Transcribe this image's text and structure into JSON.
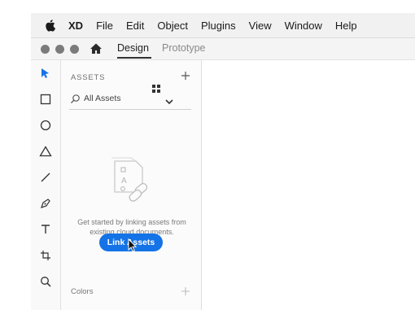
{
  "menu": {
    "apple_icon": "apple-icon",
    "app_name": "XD",
    "items": [
      "File",
      "Edit",
      "Object",
      "Plugins",
      "View",
      "Window",
      "Help"
    ]
  },
  "toolbar": {
    "tabs": [
      {
        "label": "Design",
        "active": true
      },
      {
        "label": "Prototype",
        "active": false
      }
    ],
    "home_icon": "home-icon"
  },
  "tools": [
    "select-icon",
    "rectangle-icon",
    "ellipse-icon",
    "polygon-icon",
    "line-icon",
    "pen-icon",
    "text-icon",
    "artboard-icon",
    "zoom-icon"
  ],
  "assets_panel": {
    "title": "ASSETS",
    "filter_value": "All Assets",
    "empty_message": "Get started by linking assets from existing cloud documents.",
    "link_button_label": "Link Assets",
    "colors_label": "Colors"
  },
  "colors": {
    "accent": "#1473e6",
    "tool_active": "#1473e6"
  }
}
